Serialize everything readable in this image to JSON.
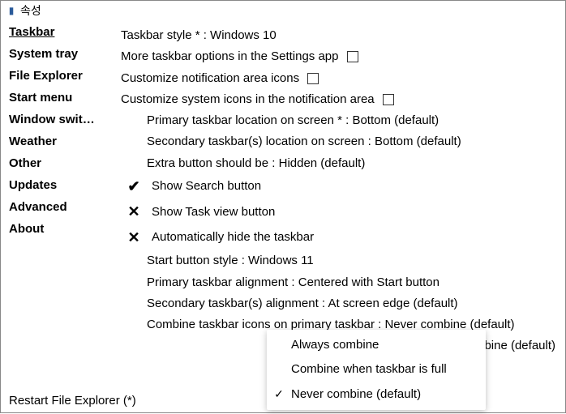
{
  "window": {
    "title": "속성"
  },
  "sidebar": {
    "items": [
      {
        "label": "Taskbar",
        "active": true
      },
      {
        "label": "System tray"
      },
      {
        "label": "File Explorer"
      },
      {
        "label": "Start menu"
      },
      {
        "label": "Window swit…"
      },
      {
        "label": "Weather"
      },
      {
        "label": "Other"
      },
      {
        "label": "Updates"
      },
      {
        "label": "Advanced"
      },
      {
        "label": "About"
      }
    ]
  },
  "settings": {
    "taskbar_style": "Taskbar style * : Windows 10",
    "more_options": "More taskbar options in the Settings app",
    "customize_notif": "Customize notification area icons",
    "customize_sys_icons": "Customize system icons in the notification area",
    "primary_location": "Primary taskbar location on screen * : Bottom (default)",
    "secondary_location": "Secondary taskbar(s) location on screen : Bottom (default)",
    "extra_button": "Extra button should be : Hidden (default)",
    "show_search": "Show Search button",
    "show_taskview": "Show Task view button",
    "auto_hide": "Automatically hide the taskbar",
    "start_style": "Start button style : Windows 11",
    "primary_align": "Primary taskbar alignment : Centered with Start button",
    "secondary_align": "Secondary taskbar(s) alignment : At screen edge (default)",
    "combine_primary": "Combine taskbar icons on primary taskbar : Never combine (default)",
    "combine_secondary_tail": "r(s) : Never combine (default)"
  },
  "marks": {
    "show_search": "✔",
    "show_taskview": "✕",
    "auto_hide": "✕"
  },
  "dropdown": {
    "items": [
      {
        "label": "Always combine",
        "checked": false
      },
      {
        "label": "Combine when taskbar is full",
        "checked": false
      },
      {
        "label": "Never combine (default)",
        "checked": true
      }
    ]
  },
  "footer": {
    "restart": "Restart File Explorer (*)"
  }
}
